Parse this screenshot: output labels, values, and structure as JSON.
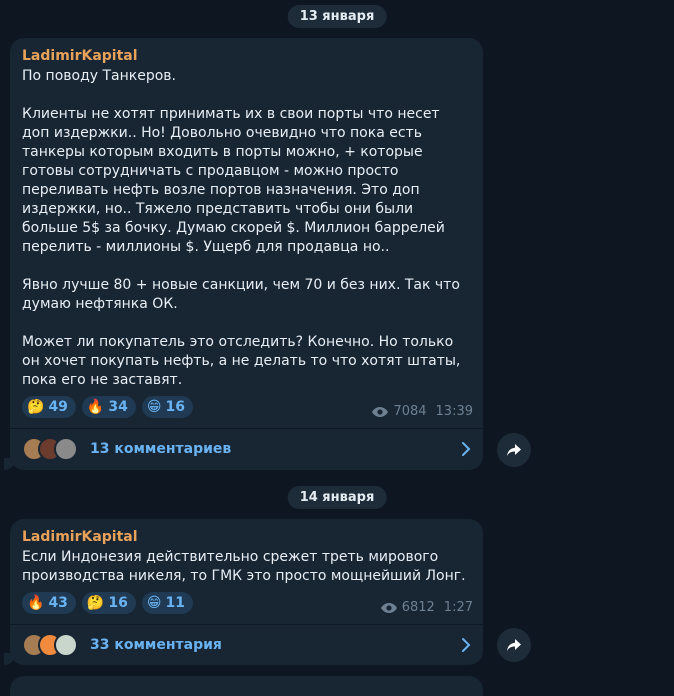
{
  "dates": [
    "13 января",
    "14 января"
  ],
  "messages": [
    {
      "author": "LadimirKapital",
      "text": "По поводу Танкеров.\n\nКлиенты не хотят принимать их в свои порты что несет доп издержки.. Но! Довольно очевидно что пока есть танкеры которым входить в порты можно, + которые готовы сотрудничать с продавцом - можно просто переливать нефть возле портов назначения. Это доп издержки, но.. Тяжело представить чтобы они были больше 5$ за бочку. Думаю скорей $. Миллион баррелей перелить - миллионы $. Ущерб для продавца но..\n\nЯвно лучше 80 + новые санкции, чем 70 и без них. Так что думаю нефтянка ОК.\n\nМожет ли покупатель это отследить? Конечно. Но только он хочет покупать нефть, а не делать то что хотят штаты, пока его не заставят.",
      "reactions": [
        {
          "emoji": "🤔",
          "count": "49"
        },
        {
          "emoji": "🔥",
          "count": "34"
        },
        {
          "emoji": "😁",
          "count": "16"
        }
      ],
      "views": "7084",
      "time": "13:39",
      "comments_label": "13 комментариев"
    },
    {
      "author": "LadimirKapital",
      "text": "Если Индонезия действительно срежет треть мирового производства никеля, то ГМК это просто мощнейший Лонг.",
      "reactions": [
        {
          "emoji": "🔥",
          "count": "43"
        },
        {
          "emoji": "🤔",
          "count": "16"
        },
        {
          "emoji": "😁",
          "count": "11"
        }
      ],
      "views": "6812",
      "time": "1:27",
      "comments_label": "33 комментария"
    }
  ]
}
